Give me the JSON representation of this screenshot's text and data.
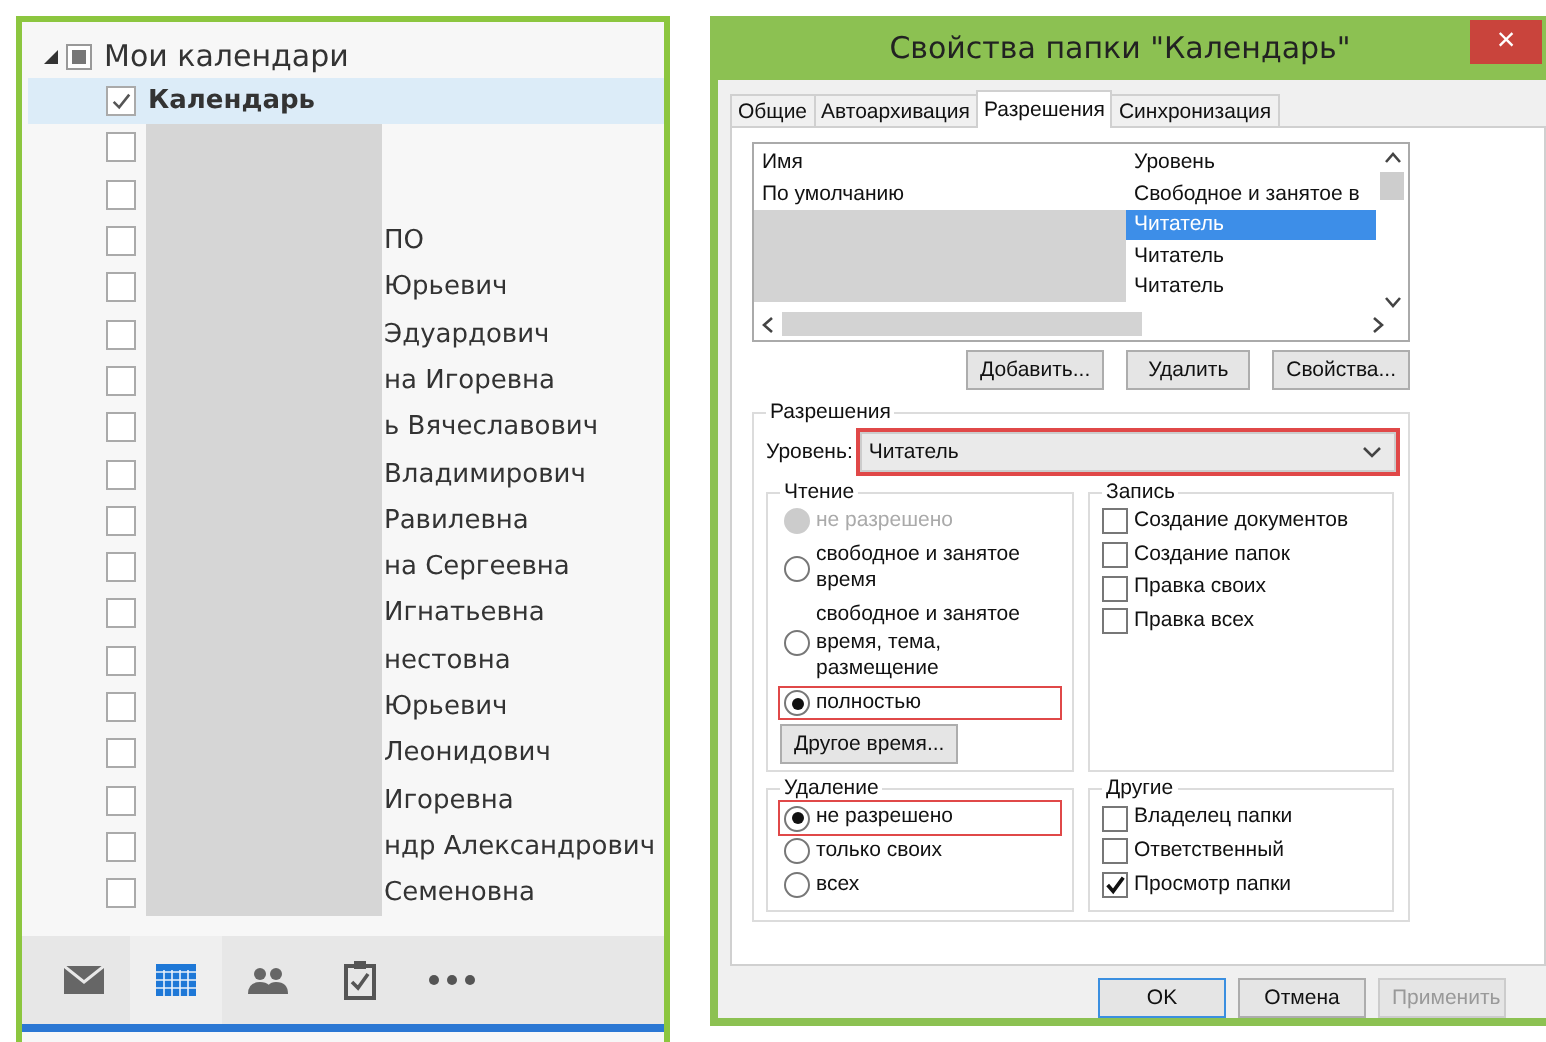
{
  "calendar_pane": {
    "header": {
      "title": "Мои календари",
      "expanded": true
    },
    "calendars": [
      {
        "name": "Календарь",
        "checked": true,
        "selected": true,
        "redacted": false
      },
      {
        "checked": false,
        "selected": false,
        "redacted": true
      },
      {
        "checked": false,
        "selected": false,
        "redacted": true
      },
      {
        "name": "ПО",
        "checked": false,
        "selected": false,
        "redacted": true
      },
      {
        "name": "Юрьевич",
        "checked": false,
        "selected": false,
        "redacted": true
      },
      {
        "name": "Эдуардович",
        "checked": false,
        "selected": false,
        "redacted": true
      },
      {
        "name": "на Игоревна",
        "checked": false,
        "selected": false,
        "redacted": true
      },
      {
        "name": "ь Вячеславович",
        "checked": false,
        "selected": false,
        "redacted": true
      },
      {
        "name": "Владимирович",
        "checked": false,
        "selected": false,
        "redacted": true
      },
      {
        "name": "Равилевна",
        "checked": false,
        "selected": false,
        "redacted": true
      },
      {
        "name": "на Сергеевна",
        "checked": false,
        "selected": false,
        "redacted": true
      },
      {
        "name": "Игнатьевна",
        "checked": false,
        "selected": false,
        "redacted": true
      },
      {
        "name": "нестовна",
        "checked": false,
        "selected": false,
        "redacted": true
      },
      {
        "name": "Юрьевич",
        "checked": false,
        "selected": false,
        "redacted": true
      },
      {
        "name": "Леонидович",
        "checked": false,
        "selected": false,
        "redacted": true
      },
      {
        "name": "Игоревна",
        "checked": false,
        "selected": false,
        "redacted": true
      },
      {
        "name": "ндр Александрович",
        "checked": false,
        "selected": false,
        "redacted": true
      },
      {
        "name": "Семеновна",
        "checked": false,
        "selected": false,
        "redacted": true
      }
    ],
    "nav": [
      {
        "kind": "mail",
        "selected": false
      },
      {
        "kind": "calendar",
        "selected": true
      },
      {
        "kind": "people",
        "selected": false
      },
      {
        "kind": "tasks",
        "selected": false
      },
      {
        "kind": "more",
        "selected": false
      }
    ]
  },
  "dialog": {
    "title": "Свойства папки \"Календарь\"",
    "close": "×",
    "tabs": [
      {
        "label": "Общие",
        "selected": false
      },
      {
        "label": "Автоархивация",
        "selected": false
      },
      {
        "label": "Разрешения",
        "selected": true
      },
      {
        "label": "Синхронизация",
        "selected": false
      }
    ],
    "permission_list": {
      "columns": [
        "Имя",
        "Уровень"
      ],
      "rows": [
        {
          "name": "По умолчанию",
          "permission": "Свободное и занятое в",
          "selected": false,
          "redacted": false
        },
        {
          "permission": "Читатель",
          "selected": true,
          "redacted": true
        },
        {
          "permission": "Читатель",
          "selected": false,
          "redacted": true
        },
        {
          "permission": "Читатель",
          "selected": false,
          "redacted": true
        }
      ]
    },
    "list_buttons": [
      "Добавить...",
      "Удалить",
      "Свойства..."
    ],
    "permissions": {
      "title": "Разрешения",
      "level_label": "Уровень:",
      "level_value": "Читатель",
      "level_highlighted": true,
      "read": {
        "title": "Чтение",
        "options": [
          {
            "label": "не разрешено",
            "selected": false,
            "disabled": true,
            "highlighted": false
          },
          {
            "label": "свободное и занятое время",
            "selected": false,
            "disabled": false,
            "highlighted": false
          },
          {
            "label": "свободное и занятое время, тема, размещение",
            "selected": false,
            "disabled": false,
            "highlighted": false
          },
          {
            "label": "полностью",
            "selected": true,
            "disabled": false,
            "highlighted": true
          }
        ],
        "button": "Другое время..."
      },
      "write": {
        "title": "Запись",
        "options": [
          {
            "label": "Создание документов",
            "checked": false
          },
          {
            "label": "Создание папок",
            "checked": false
          },
          {
            "label": "Правка своих",
            "checked": false
          },
          {
            "label": "Правка всех",
            "checked": false
          }
        ]
      },
      "delete": {
        "title": "Удаление",
        "options": [
          {
            "label": "не разрешено",
            "selected": true,
            "disabled": false,
            "highlighted": true
          },
          {
            "label": "только своих",
            "selected": false,
            "disabled": false,
            "highlighted": false
          },
          {
            "label": "всех",
            "selected": false,
            "disabled": false,
            "highlighted": false
          }
        ]
      },
      "other": {
        "title": "Другие",
        "options": [
          {
            "label": "Владелец папки",
            "checked": false
          },
          {
            "label": "Ответственный",
            "checked": false
          },
          {
            "label": "Просмотр папки",
            "checked": true
          }
        ]
      }
    },
    "footer_buttons": [
      {
        "label": "OK",
        "default": true,
        "disabled": false
      },
      {
        "label": "Отмена",
        "default": false,
        "disabled": false
      },
      {
        "label": "Применить",
        "default": false,
        "disabled": true
      }
    ]
  }
}
